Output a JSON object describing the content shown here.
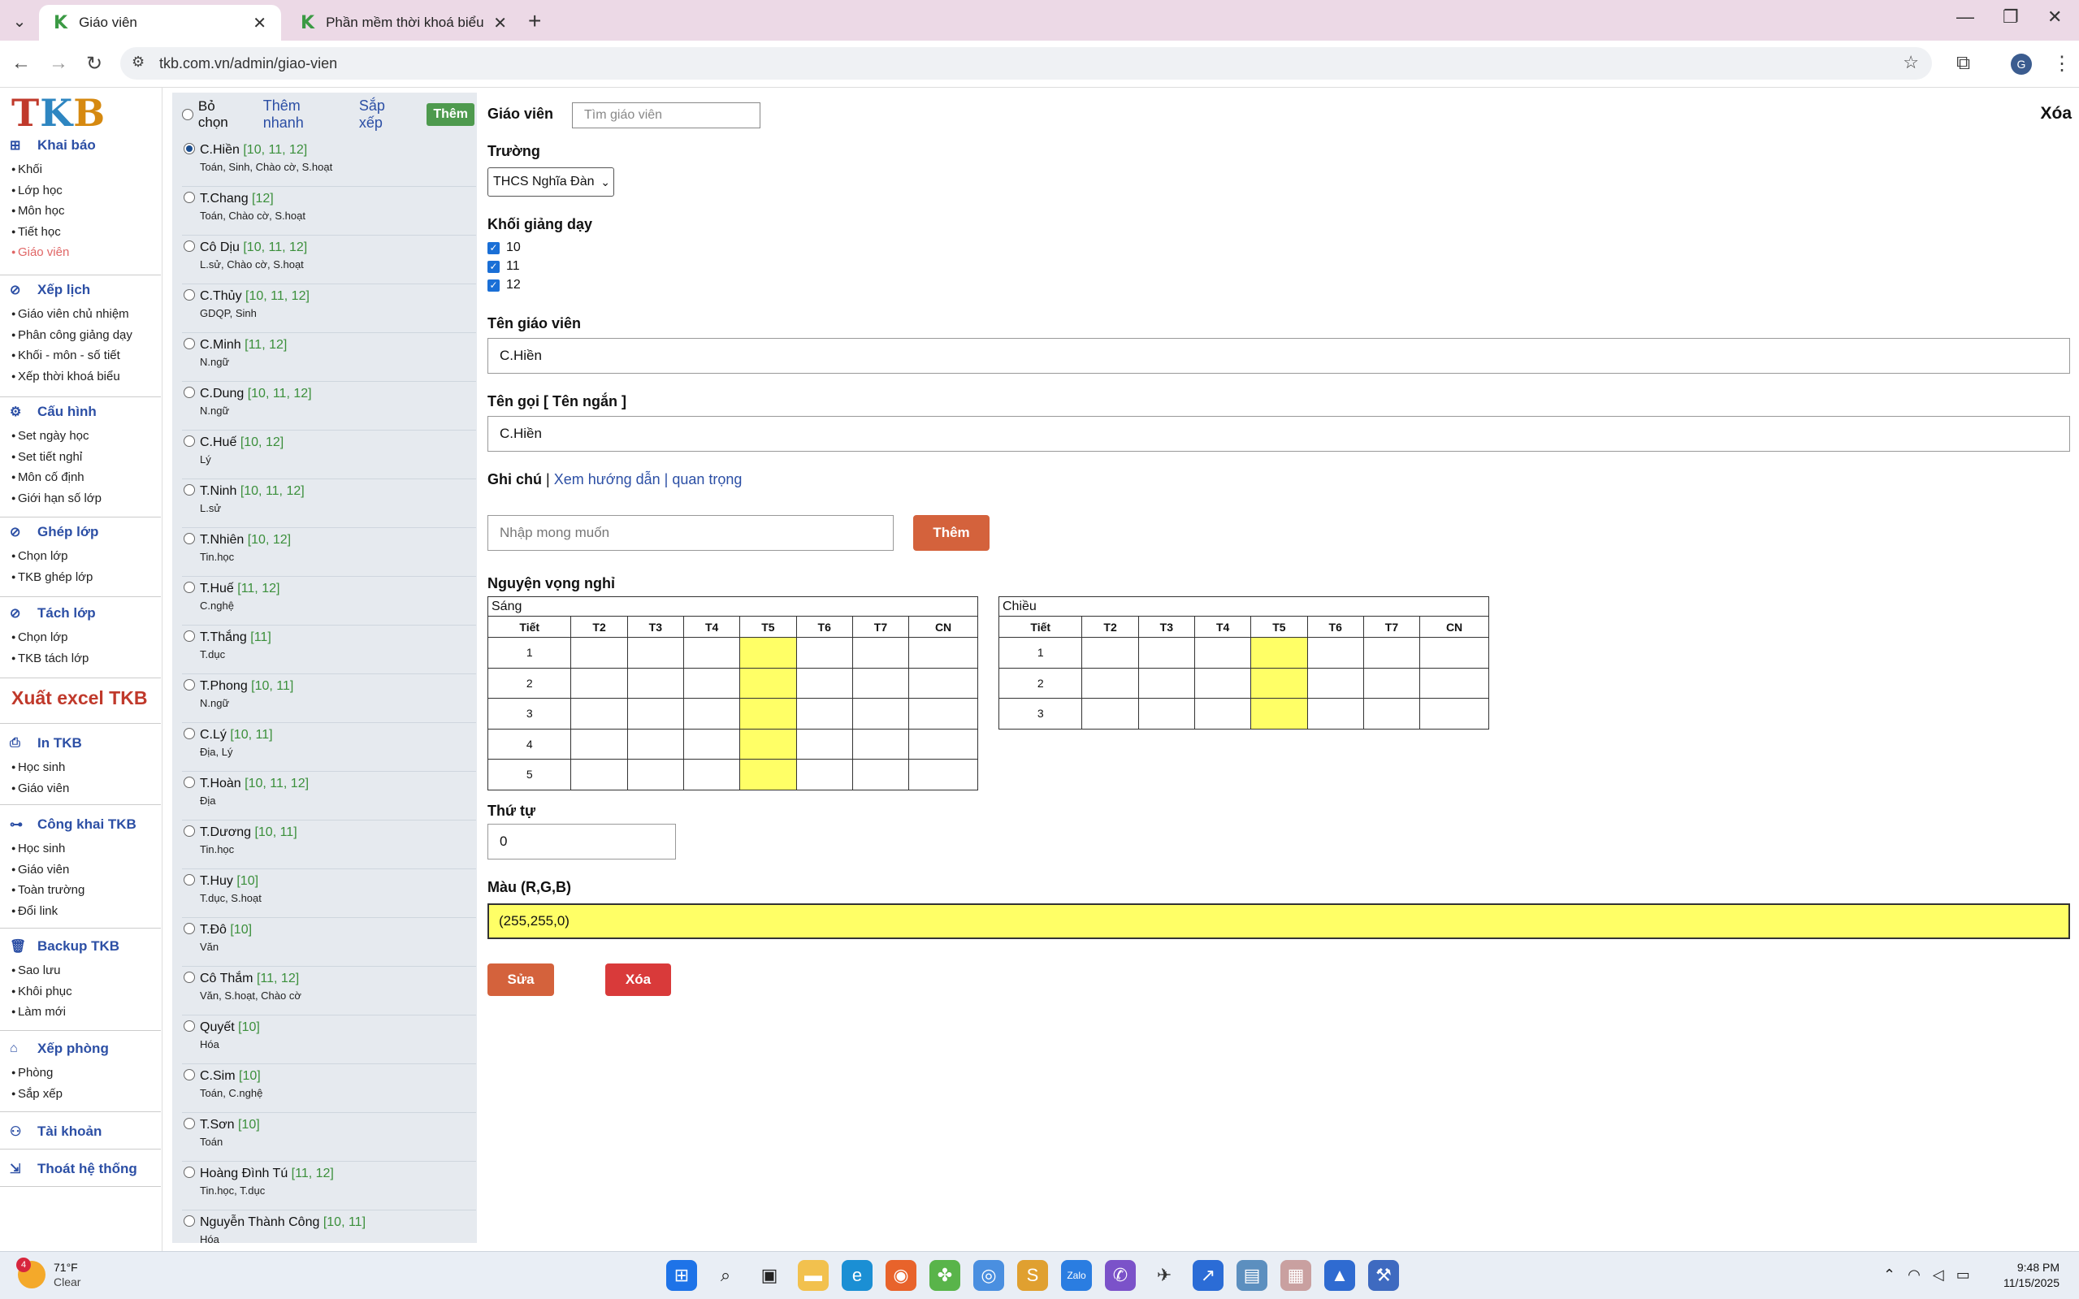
{
  "browser": {
    "tabs": [
      {
        "label": "Giáo viên",
        "active": true
      },
      {
        "label": "Phần mềm thời khoá biểu",
        "active": false
      }
    ],
    "url": "tkb.com.vn/admin/giao-vien",
    "profile_initial": "G"
  },
  "logo": {
    "t": "T",
    "k": "K",
    "b": "B"
  },
  "nav": {
    "khaibao": {
      "title": "Khai báo",
      "items": [
        "Khối",
        "Lớp học",
        "Môn học",
        "Tiết học",
        "Giáo viên"
      ]
    },
    "xeplich": {
      "title": "Xếp lịch",
      "items": [
        "Giáo viên chủ nhiệm",
        "Phân công giảng dạy",
        "Khối - môn - số tiết",
        "Xếp thời khoá biểu"
      ]
    },
    "cauhinh": {
      "title": "Cấu hình",
      "items": [
        "Set ngày học",
        "Set tiết nghỉ",
        "Môn cố định",
        "Giới hạn số lớp"
      ]
    },
    "gheplop": {
      "title": "Ghép lớp",
      "items": [
        "Chọn lớp",
        "TKB ghép lớp"
      ]
    },
    "tachlop": {
      "title": "Tách lớp",
      "items": [
        "Chọn lớp",
        "TKB tách lớp"
      ]
    },
    "xuat_excel": "Xuất excel TKB",
    "intkb": {
      "title": "In TKB",
      "items": [
        "Học sinh",
        "Giáo viên"
      ]
    },
    "congkhai": {
      "title": "Công khai TKB",
      "items": [
        "Học sinh",
        "Giáo viên",
        "Toàn trường",
        "Đổi link"
      ]
    },
    "backup": {
      "title": "Backup TKB",
      "items": [
        "Sao lưu",
        "Khôi phục",
        "Làm mới"
      ]
    },
    "xepphong": {
      "title": "Xếp phòng",
      "items": [
        "Phòng",
        "Sắp xếp"
      ]
    },
    "taikhoan": "Tài khoản",
    "thoat": "Thoát hệ thống"
  },
  "list_toolbar": {
    "deselect": "Bỏ chọn",
    "quick_add": "Thêm nhanh",
    "sort": "Sắp xếp",
    "add": "Thêm"
  },
  "teachers": [
    {
      "name": "C.Hiền",
      "grades": "[10, 11, 12]",
      "subjects": "Toán, Sinh, Chào cờ, S.hoạt",
      "selected": true
    },
    {
      "name": "T.Chang",
      "grades": "[12]",
      "subjects": "Toán, Chào cờ, S.hoạt"
    },
    {
      "name": "Cô Dịu",
      "grades": "[10, 11, 12]",
      "subjects": "L.sử, Chào cờ, S.hoạt"
    },
    {
      "name": "C.Thủy",
      "grades": "[10, 11, 12]",
      "subjects": "GDQP, Sinh"
    },
    {
      "name": "C.Minh",
      "grades": "[11, 12]",
      "subjects": "N.ngữ"
    },
    {
      "name": "C.Dung",
      "grades": "[10, 11, 12]",
      "subjects": "N.ngữ"
    },
    {
      "name": "C.Huế",
      "grades": "[10, 12]",
      "subjects": "Lý"
    },
    {
      "name": "T.Ninh",
      "grades": "[10, 11, 12]",
      "subjects": "L.sử"
    },
    {
      "name": "T.Nhiên",
      "grades": "[10, 12]",
      "subjects": "Tin.học"
    },
    {
      "name": "T.Huế",
      "grades": "[11, 12]",
      "subjects": "C.nghệ"
    },
    {
      "name": "T.Thắng",
      "grades": "[11]",
      "subjects": "T.dục"
    },
    {
      "name": "T.Phong",
      "grades": "[10, 11]",
      "subjects": "N.ngữ"
    },
    {
      "name": "C.Lý",
      "grades": "[10, 11]",
      "subjects": "Địa, Lý"
    },
    {
      "name": "T.Hoàn",
      "grades": "[10, 11, 12]",
      "subjects": "Địa"
    },
    {
      "name": "T.Dương",
      "grades": "[10, 11]",
      "subjects": "Tin.học"
    },
    {
      "name": "T.Huy",
      "grades": "[10]",
      "subjects": "T.dục, S.hoạt"
    },
    {
      "name": "T.Đô",
      "grades": "[10]",
      "subjects": "Văn"
    },
    {
      "name": "Cô Thắm",
      "grades": "[11, 12]",
      "subjects": "Văn, S.hoạt, Chào cờ"
    },
    {
      "name": "Quyết",
      "grades": "[10]",
      "subjects": "Hóa"
    },
    {
      "name": "C.Sim",
      "grades": "[10]",
      "subjects": "Toán, C.nghệ"
    },
    {
      "name": "T.Sơn",
      "grades": "[10]",
      "subjects": "Toán"
    },
    {
      "name": "Hoàng Đình Tú",
      "grades": "[11, 12]",
      "subjects": "Tin.học, T.dục"
    },
    {
      "name": "Nguyễn Thành Công",
      "grades": "[10, 11]",
      "subjects": "Hóa"
    }
  ],
  "form": {
    "title": "Giáo viên",
    "search_placeholder": "Tìm giáo viên",
    "delete_top": "Xóa",
    "school_label": "Trường",
    "school_value": "THCS Nghĩa Đàn",
    "grades_label": "Khối giảng dạy",
    "grades": [
      "10",
      "11",
      "12"
    ],
    "name_label": "Tên giáo viên",
    "name_value": "C.Hiền",
    "short_label": "Tên gọi [ Tên ngắn ]",
    "short_value": "C.Hiền",
    "note_label": "Ghi chú",
    "note_sep": "|",
    "note_link": "Xem hướng dẫn | quan trọng",
    "wish_placeholder": "Nhập mong muốn",
    "wish_add": "Thêm",
    "leave_label": "Nguyện vọng nghỉ",
    "order_label": "Thứ tự",
    "order_value": "0",
    "color_label": "Màu (R,G,B)",
    "color_value": "(255,255,0)",
    "edit_button": "Sửa",
    "delete_button": "Xóa"
  },
  "schedule": {
    "columns": [
      "Tiết",
      "T2",
      "T3",
      "T4",
      "T5",
      "T6",
      "T7",
      "CN"
    ],
    "morning": {
      "caption": "Sáng",
      "periods": [
        "1",
        "2",
        "3",
        "4",
        "5"
      ]
    },
    "afternoon": {
      "caption": "Chiều",
      "periods": [
        "1",
        "2",
        "3"
      ]
    },
    "highlight_day": "T5",
    "highlight_color": "#ffff66"
  },
  "taskbar": {
    "temp": "71°F",
    "condition": "Clear",
    "weather_badge": "4",
    "time": "9:48 PM",
    "date": "11/15/2025"
  },
  "colors": {
    "accent_orange": "#d4623c",
    "delete_red": "#d93a3a",
    "nav_blue": "#2c4fa5",
    "add_green": "#4e9a4e",
    "yellow": "#ffff66"
  }
}
